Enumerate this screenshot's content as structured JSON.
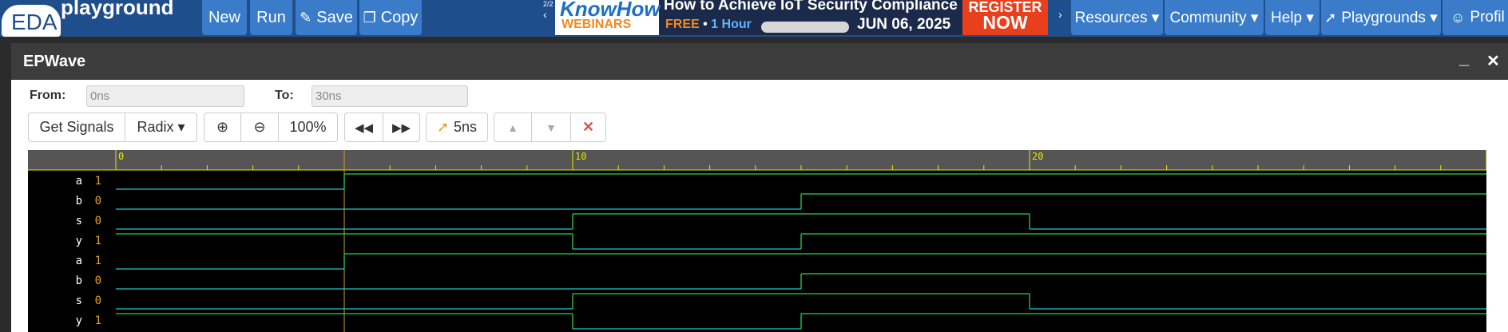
{
  "navbar": {
    "logo_main": "EDA",
    "logo_sub": "playground",
    "buttons": [
      {
        "label": "New",
        "icon": ""
      },
      {
        "label": "Run",
        "icon": ""
      },
      {
        "label": "Save",
        "icon": "pencil-icon"
      },
      {
        "label": "Copy",
        "icon": "copy-icon"
      }
    ],
    "menus": [
      {
        "label": "Resources ▾"
      },
      {
        "label": "Community ▾"
      },
      {
        "label": "Help ▾"
      },
      {
        "label": "Playgrounds ▾",
        "icon": "rocket-icon"
      },
      {
        "label": "Profil",
        "icon": "user-icon"
      }
    ],
    "ad": {
      "counter": "2/2",
      "brand_top": "KnowHow",
      "brand_bottom": "WEBINARS",
      "title": "How to Achieve IoT Security Compliance",
      "free": "FREE",
      "sep": " • ",
      "hour": "1 Hour",
      "date": "JUN 06, 2025",
      "register": "REGISTER",
      "now": "NOW"
    }
  },
  "dialog": {
    "title": "EPWave",
    "minimize": "_",
    "close": "✕",
    "from_label": "From:",
    "from_value": "0ns",
    "to_label": "To:",
    "to_value": "30ns",
    "toolbar": {
      "get_signals": "Get Signals",
      "radix": "Radix ▾",
      "zoom_in": "⊕",
      "zoom_out": "⊖",
      "zoom_level": "100%",
      "prev": "◀◀",
      "next": "▶▶",
      "step": "5ns",
      "up": "▲",
      "down": "▼",
      "delete": "✕"
    }
  },
  "waveform": {
    "time_labels": [
      "0",
      "10",
      "20"
    ],
    "time_label_values": [
      0,
      10,
      20
    ],
    "range_ns": [
      0,
      30
    ],
    "cursor_time": 5,
    "signals": [
      {
        "name": "a",
        "value": "1",
        "transitions": [
          [
            0,
            0
          ],
          [
            5,
            1
          ]
        ]
      },
      {
        "name": "b",
        "value": "0",
        "transitions": [
          [
            0,
            0
          ],
          [
            15,
            1
          ]
        ]
      },
      {
        "name": "s",
        "value": "0",
        "transitions": [
          [
            0,
            0
          ],
          [
            10,
            1
          ],
          [
            20,
            0
          ]
        ]
      },
      {
        "name": "y",
        "value": "1",
        "transitions": [
          [
            0,
            1
          ],
          [
            10,
            0
          ],
          [
            15,
            1
          ]
        ]
      },
      {
        "name": "a",
        "value": "1",
        "transitions": [
          [
            0,
            0
          ],
          [
            5,
            1
          ]
        ]
      },
      {
        "name": "b",
        "value": "0",
        "transitions": [
          [
            0,
            0
          ],
          [
            15,
            1
          ]
        ]
      },
      {
        "name": "s",
        "value": "0",
        "transitions": [
          [
            0,
            0
          ],
          [
            10,
            1
          ],
          [
            20,
            0
          ]
        ]
      },
      {
        "name": "y",
        "value": "1",
        "transitions": [
          [
            0,
            1
          ],
          [
            10,
            0
          ],
          [
            15,
            1
          ]
        ]
      }
    ],
    "colors": {
      "low": "#21c7c7",
      "high": "#2ad14a",
      "cursor": "#c9a227",
      "ruler": "#e8e800",
      "value": "#e8a21c"
    }
  }
}
